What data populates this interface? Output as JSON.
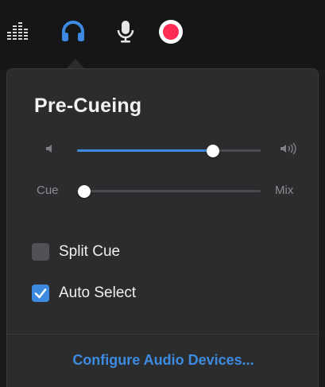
{
  "toolbar": {
    "icons": [
      "equalizer-icon",
      "headphones-icon",
      "microphone-icon",
      "record-icon"
    ],
    "active": "headphones-icon",
    "record_color": "#ff2d55",
    "active_color": "#3c8be0"
  },
  "panel": {
    "title": "Pre-Cueing",
    "volume_slider": {
      "value": 0.74,
      "min_icon": "speaker-low-icon",
      "max_icon": "speaker-high-icon"
    },
    "cue_mix_slider": {
      "left_label": "Cue",
      "right_label": "Mix",
      "value": 0.04
    },
    "options": [
      {
        "label": "Split Cue",
        "checked": false
      },
      {
        "label": "Auto Select",
        "checked": true
      }
    ],
    "configure_link": "Configure Audio Devices..."
  }
}
